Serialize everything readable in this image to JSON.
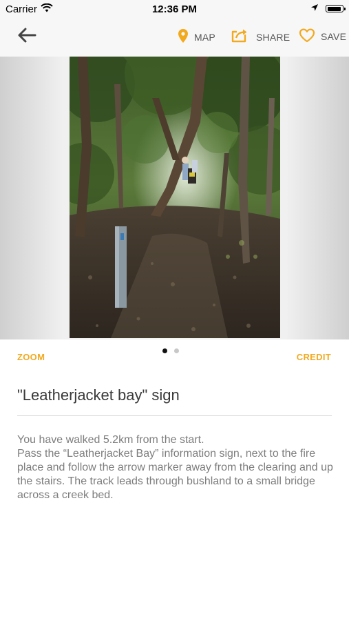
{
  "status_bar": {
    "carrier": "Carrier",
    "time": "12:36 PM",
    "battery_level": 0.95
  },
  "toolbar": {
    "map_label": "MAP",
    "share_label": "SHARE",
    "save_label": "SAVE",
    "accent_color": "#f2a91e",
    "icons": [
      "arrow-left-icon",
      "map-pin-icon",
      "share-icon",
      "heart-icon"
    ]
  },
  "gallery": {
    "zoom_label": "ZOOM",
    "credit_label": "CREDIT",
    "page_count": 2,
    "current_page": 1
  },
  "step": {
    "title": "\"Leatherjacket bay\" sign",
    "description": [
      "You have walked 5.2km from the start.",
      "Pass the “Leatherjacket Bay” information sign, next to the fire place and follow the arrow marker away from the clearing and up the stairs. The track leads through bushland to a small bridge across a creek bed."
    ]
  }
}
